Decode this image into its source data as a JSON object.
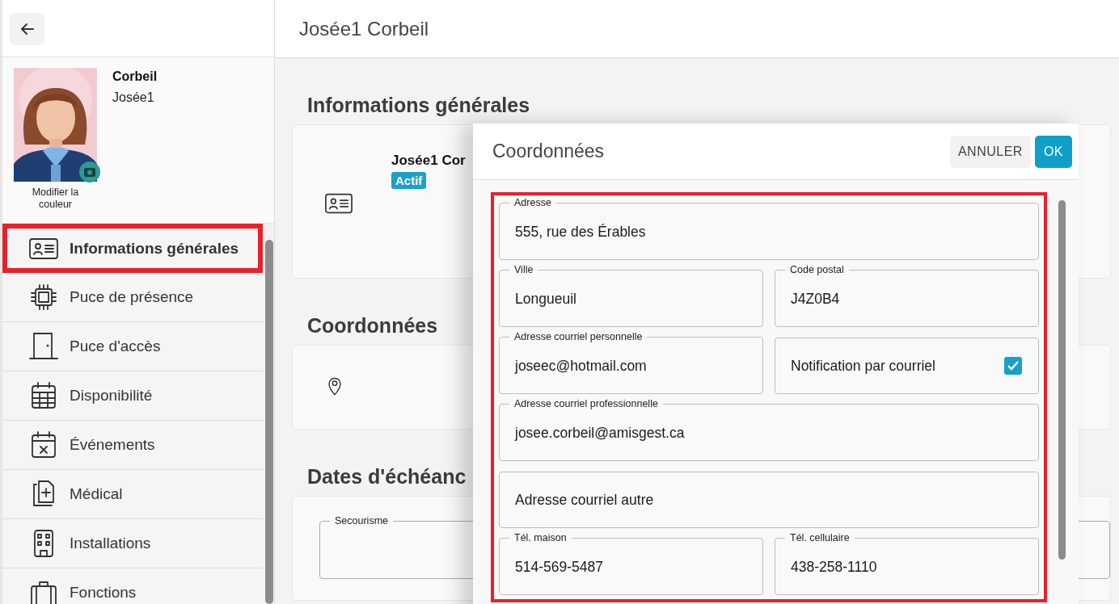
{
  "profile": {
    "last_name": "Corbeil",
    "first_name": "Josée1",
    "photo_caption": "Modifier la couleur"
  },
  "sidebar": {
    "items": [
      {
        "label": "Informations générales",
        "selected": true
      },
      {
        "label": "Puce de présence",
        "selected": false
      },
      {
        "label": "Puce d'accès",
        "selected": false
      },
      {
        "label": "Disponibilité",
        "selected": false
      },
      {
        "label": "Événements",
        "selected": false
      },
      {
        "label": "Médical",
        "selected": false
      },
      {
        "label": "Installations",
        "selected": false
      },
      {
        "label": "Fonctions",
        "selected": false
      }
    ]
  },
  "page_title": "Josée1 Corbeil",
  "sections": [
    {
      "title": "Informations générales",
      "kind": "identity",
      "name": "Josée1 Cor",
      "status": "Actif"
    },
    {
      "title": "Coordonnées",
      "kind": "address"
    },
    {
      "title": "Dates d'échéanc",
      "kind": "dates",
      "fields": [
        {
          "label": "Secourisme"
        }
      ]
    }
  ],
  "dialog": {
    "title": "Coordonnées",
    "buttons": [
      {
        "label": "ANNULER",
        "kind": "secondary"
      },
      {
        "label": "OK",
        "kind": "primary"
      }
    ],
    "rows": [
      [
        {
          "kind": "text",
          "label": "Adresse",
          "value": "555, rue des Érables"
        }
      ],
      [
        {
          "kind": "text",
          "label": "Ville",
          "value": "Longueuil"
        },
        {
          "kind": "text",
          "label": "Code postal",
          "value": "J4Z0B4"
        }
      ],
      [
        {
          "kind": "text",
          "label": "Adresse courriel personnelle",
          "value": "joseec@hotmail.com"
        },
        {
          "kind": "checkbox",
          "label": "Notification par courriel",
          "checked": true
        }
      ],
      [
        {
          "kind": "text",
          "label": "Adresse courriel professionnelle",
          "value": "josee.corbeil@amisgest.ca"
        }
      ],
      [
        {
          "kind": "empty",
          "placeholder": "Adresse courriel autre"
        }
      ],
      [
        {
          "kind": "text",
          "label": "Tél. maison",
          "value": "514-569-5487"
        },
        {
          "kind": "text",
          "label": "Tél. cellulaire",
          "value": "438-258-1110"
        }
      ]
    ]
  }
}
